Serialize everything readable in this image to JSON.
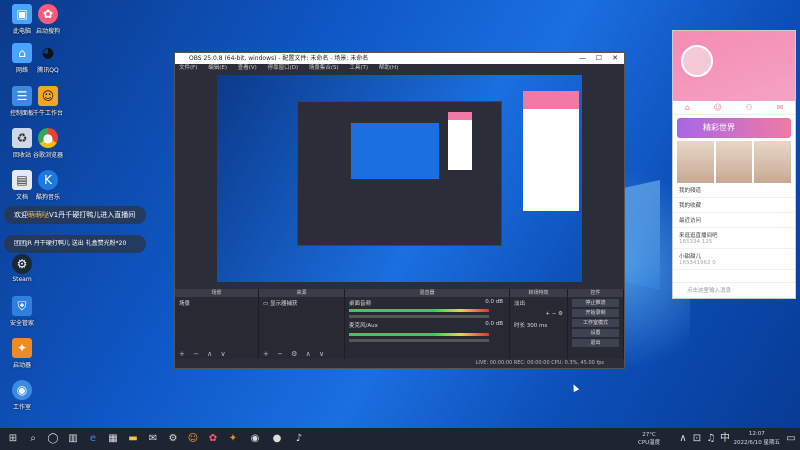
{
  "desktop": {
    "icons": [
      {
        "label": "此电脑",
        "icon": "computer-icon",
        "color": "#4aa3ff"
      },
      {
        "label": "启动搜狗",
        "icon": "sogou-icon",
        "color": "#ff5a7a"
      },
      {
        "label": "网络",
        "icon": "network-icon",
        "color": "#4aa3ff"
      },
      {
        "label": "腾讯QQ",
        "icon": "qq-icon",
        "color": "#222222"
      },
      {
        "label": "控制面板",
        "icon": "control-panel-icon",
        "color": "#3b8ce0"
      },
      {
        "label": "千牛工作台",
        "icon": "qianniu-icon",
        "color": "#f5a623"
      },
      {
        "label": "回收站",
        "icon": "recycle-bin-icon",
        "color": "#cfd8e6"
      },
      {
        "label": "谷歌浏览器",
        "icon": "chrome-icon",
        "color": "#e94235"
      },
      {
        "label": "文档",
        "icon": "document-icon",
        "color": "#e5e9f0"
      },
      {
        "label": "酷狗音乐",
        "icon": "kugou-icon",
        "color": "#1f7ae0"
      },
      {
        "label": "Steam",
        "icon": "steam-icon",
        "color": "#1b2838"
      },
      {
        "label": "安全管家",
        "icon": "shield-icon",
        "color": "#2f7fe0"
      },
      {
        "label": "启动器",
        "icon": "launcher-icon",
        "color": "#f08a24"
      },
      {
        "label": "工作室",
        "icon": "studio-icon",
        "color": "#3b8ce0"
      }
    ]
  },
  "chat": {
    "line1_prefix": "欢迎",
    "line1_name": "萌萌哒",
    "line1_suffix": "V1丹千硬打鸭儿进入直播间",
    "line2": "团团JR 丹干硬打鸭儿 送出 礼盒赞光粉*20"
  },
  "obs": {
    "title": "OBS 25.0.8 (64-bit, windows) - 配置文件: 未命名 - 场景: 未命名",
    "menu": [
      "文件(F)",
      "编辑(E)",
      "查看(V)",
      "停靠窗口(D)",
      "场景集合(S)",
      "工具(T)",
      "帮助(H)"
    ],
    "docks": {
      "scenes": {
        "header": "场景",
        "item": "场景"
      },
      "sources": {
        "header": "来源",
        "item": "显示器捕获"
      },
      "mixer": {
        "header": "混音器",
        "track1": "桌面音频",
        "track2": "麦克风/Aux",
        "db1": "0.0 dB",
        "db2": "0.0 dB"
      },
      "transitions": {
        "header": "转场特效",
        "fade": "淡出",
        "duration_label": "时长",
        "duration_value": "300 ms"
      },
      "controls": {
        "header": "控件",
        "buttons": [
          "停止推流",
          "开始录制",
          "工作室模式",
          "设置",
          "退出"
        ]
      }
    },
    "status": "LIVE: 00:00:00   REC: 00:00:00   CPU: 0.3%, 45.00 fps"
  },
  "panel": {
    "tabs": [
      "主页",
      "动态",
      "消息",
      "我的"
    ],
    "banner": "精彩世界",
    "rows": [
      "我的頻道",
      "我的收藏",
      "最近访问"
    ],
    "item1": "来逛逛直播间吧",
    "item1_meta": "165334   125",
    "item2": "小甜甜儿",
    "item2_meta": "165341962   0",
    "bottom": "点击这里输入消息"
  },
  "taskbar": {
    "weather_temp": "27°C",
    "weather_desc": "CPU温度",
    "time": "12:07",
    "date": "2022/6/10 星期五"
  }
}
